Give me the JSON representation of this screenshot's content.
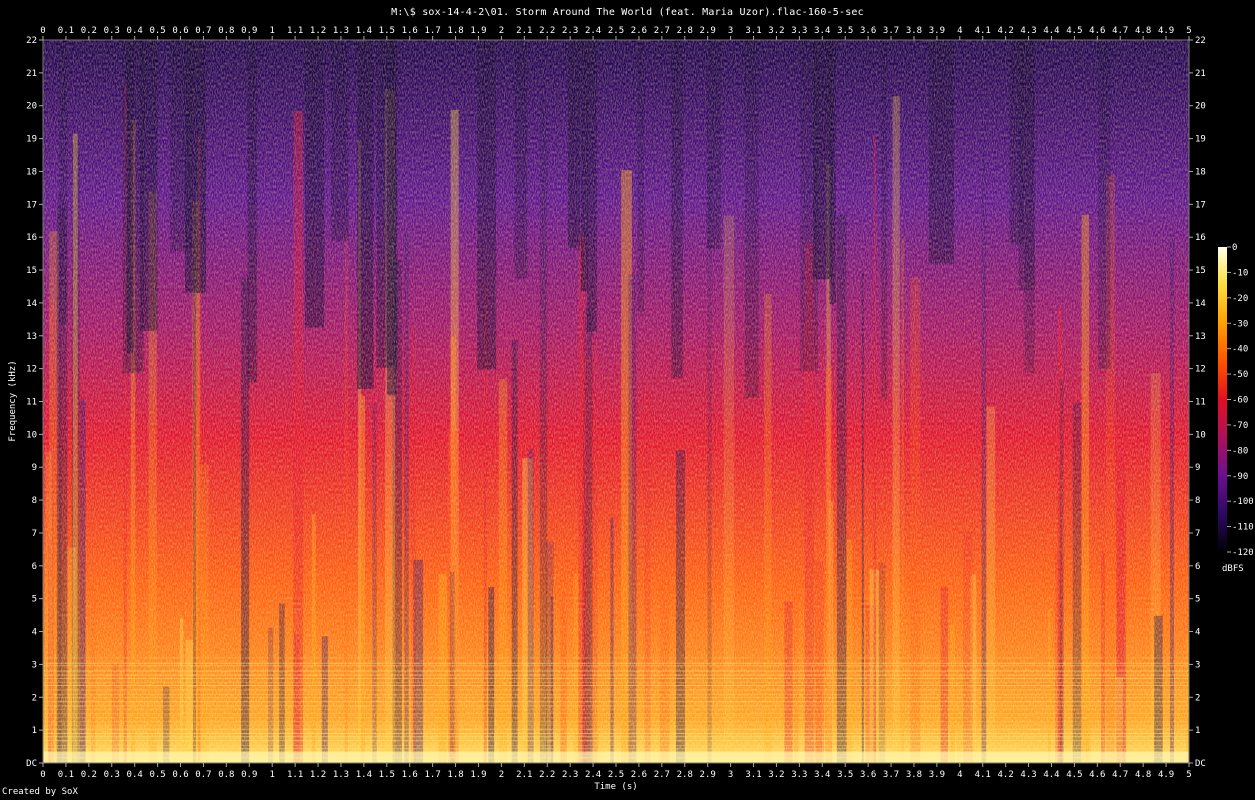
{
  "chart_data": {
    "type": "heatmap",
    "title": "M:\\$ sox-14-4-2\\01. Storm Around The World (feat. Maria Uzor).flac-160-5-sec",
    "xlabel": "Time (s)",
    "ylabel": "Frequency (kHz)",
    "xlim": [
      0,
      5
    ],
    "ylim": [
      0,
      22
    ],
    "x_ticks": [
      "0",
      "0.1",
      "0.2",
      "0.3",
      "0.4",
      "0.5",
      "0.6",
      "0.7",
      "0.8",
      "0.9",
      "1",
      "1.1",
      "1.2",
      "1.3",
      "1.4",
      "1.5",
      "1.6",
      "1.7",
      "1.8",
      "1.9",
      "2",
      "2.1",
      "2.2",
      "2.3",
      "2.4",
      "2.5",
      "2.6",
      "2.7",
      "2.8",
      "2.9",
      "3",
      "3.1",
      "3.2",
      "3.3",
      "3.4",
      "3.5",
      "3.6",
      "3.7",
      "3.8",
      "3.9",
      "4",
      "4.1",
      "4.2",
      "4.3",
      "4.4",
      "4.5",
      "4.6",
      "4.7",
      "4.8",
      "4.9",
      "5"
    ],
    "y_ticks": [
      "DC",
      "1",
      "2",
      "3",
      "4",
      "5",
      "6",
      "7",
      "8",
      "9",
      "10",
      "11",
      "12",
      "13",
      "14",
      "15",
      "16",
      "17",
      "18",
      "19",
      "20",
      "21",
      "22"
    ],
    "colorbar": {
      "label": "dBFS",
      "range": [
        -120,
        0
      ],
      "ticks": [
        "0",
        "-10",
        "-20",
        "-30",
        "-40",
        "-50",
        "-60",
        "-70",
        "-80",
        "-90",
        "-100",
        "-110",
        "-120"
      ]
    },
    "colormap": [
      "#000000",
      "#1a0044",
      "#3a0a7a",
      "#5a0f8e",
      "#8a0f7a",
      "#c0104a",
      "#ee1a1a",
      "#ff5a00",
      "#ffa000",
      "#ffe040",
      "#ffffd0"
    ],
    "description_of_intensity": {
      "low_band_db": -10,
      "mid_band_db": -40,
      "high_band_db": -90
    }
  },
  "credit": "Created by SoX"
}
